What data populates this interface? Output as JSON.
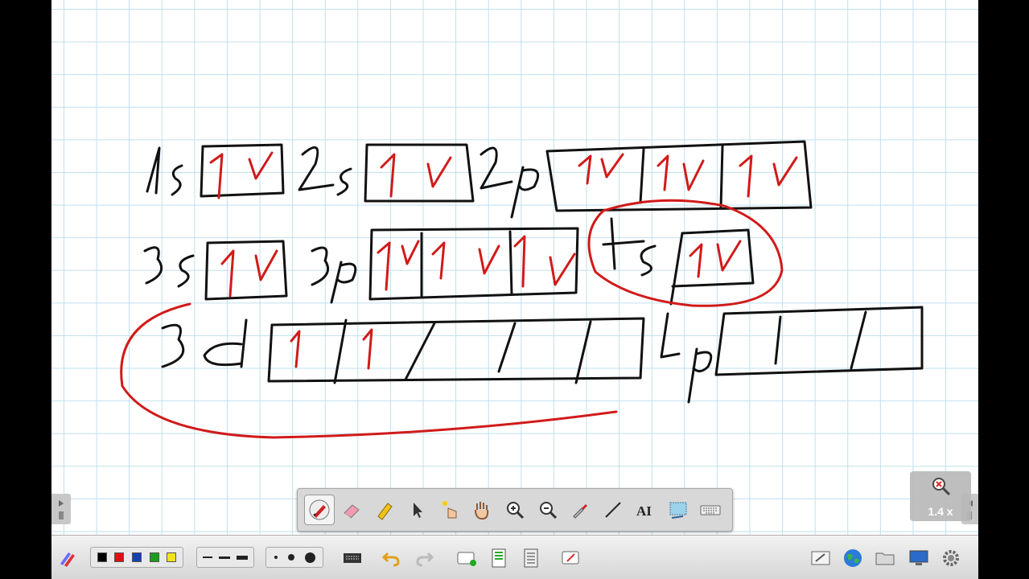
{
  "board": {
    "orbitals": [
      {
        "label": "1s",
        "boxes": 1,
        "electrons": [
          "↑↓"
        ]
      },
      {
        "label": "2s",
        "boxes": 1,
        "electrons": [
          "↑↓"
        ]
      },
      {
        "label": "2p",
        "boxes": 3,
        "electrons": [
          "↑↓",
          "↑↓",
          "↑↓"
        ]
      },
      {
        "label": "3s",
        "boxes": 1,
        "electrons": [
          "↑↓"
        ]
      },
      {
        "label": "3p",
        "boxes": 3,
        "electrons": [
          "↑↓",
          "↑↓",
          "↑↓"
        ]
      },
      {
        "label": "4s",
        "boxes": 1,
        "electrons": [
          "↑↓"
        ],
        "circled": true
      },
      {
        "label": "3d",
        "boxes": 5,
        "electrons": [
          "↑",
          "↑",
          "",
          "",
          ""
        ]
      },
      {
        "label": "4p",
        "boxes": 3,
        "electrons": [
          "",
          "",
          ""
        ]
      }
    ],
    "ink_colors": {
      "pen": "#111111",
      "electrons": "#d11a1a",
      "grid": "#bfe0ee"
    }
  },
  "zoom": {
    "label": "1.4 x"
  },
  "floating_toolbar": {
    "tools": [
      "pen-icon",
      "eraser-icon",
      "highlighter-icon",
      "pointer-icon",
      "laser-pointer-icon",
      "hand-pan-icon",
      "zoom-in-icon",
      "zoom-out-icon",
      "pipette-icon",
      "line-icon",
      "text-icon",
      "capture-icon",
      "keyboard-icon"
    ],
    "active": "pen-icon"
  },
  "bottom_toolbar": {
    "colors": [
      "#000000",
      "#e01010",
      "#1a3fb0",
      "#1aa01a",
      "#f2e21a"
    ],
    "line_widths": [
      "thin",
      "medium",
      "thick"
    ],
    "point_sizes": [
      "small",
      "medium",
      "large"
    ],
    "right_icons": [
      "whiteboard-icon",
      "globe-icon",
      "folder-icon",
      "desktop-icon",
      "settings-gear-icon"
    ]
  }
}
